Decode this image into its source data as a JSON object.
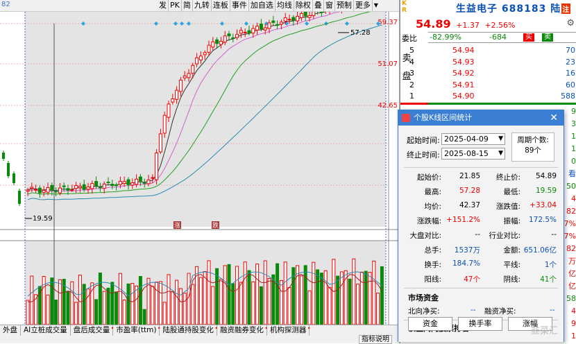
{
  "toolbar": {
    "code_fragment": "82",
    "buttons": [
      "发",
      "PK",
      "简",
      "九转",
      "连板",
      "事件",
      "加自选",
      "均线",
      "除权",
      "叠",
      "窗",
      "预制",
      "更多"
    ]
  },
  "chart": {
    "price_high_label": "57.28",
    "price_low_label": "19.59",
    "axis_labels": [
      "59.37",
      "51.07",
      "42.65"
    ],
    "event_markers": [
      "涨",
      "跌"
    ]
  },
  "bottom_tabs": [
    "外盘",
    "AI立桩成交量",
    "盘后成交量",
    "市盈率(ttm)",
    "陆股通持股变化",
    "融资融券变化",
    "机构探测器"
  ],
  "help_button": "指标说明",
  "quote": {
    "kr_badge": "KR",
    "name": "生益电子",
    "code": "688183",
    "lu_badge": "陆",
    "rz_badge": "注",
    "price": "54.89",
    "change": "+1.37",
    "change_pct": "+2.56%",
    "gear_icon": "gear-icon",
    "weibi_label": "委比",
    "weibi_value": "-82.99%",
    "weicha_value": "-684",
    "buy_label": "买",
    "sell_label": "卖",
    "ask_side_label": "卖盘",
    "asks": [
      {
        "level": "5",
        "price": "54.94",
        "volume": "70"
      },
      {
        "level": "4",
        "price": "54.93",
        "volume": "23"
      },
      {
        "level": "3",
        "price": "54.92",
        "volume": "16"
      },
      {
        "level": "2",
        "price": "54.91",
        "volume": "60"
      },
      {
        "level": "1",
        "price": "54.90",
        "volume": "588"
      }
    ],
    "side_values": [
      "9",
      "3",
      "1",
      "1",
      "0",
      "看",
      "50",
      "4",
      "82",
      "7%",
      "7%",
      "82",
      "万",
      "亿",
      "亿",
      "58",
      "4",
      "9",
      "1"
    ]
  },
  "dialog": {
    "title": "个股K线区间统计",
    "start_label": "起始时间:",
    "start_value": "2025-04-09",
    "end_label": "终止时间:",
    "end_value": "2025-08-15",
    "cycle_label": "周期个数:",
    "cycle_value": "89个",
    "stats_left": [
      {
        "label": "起始价:",
        "value": "21.85",
        "color": "black"
      },
      {
        "label": "最高:",
        "value": "57.28",
        "color": "red"
      },
      {
        "label": "均价:",
        "value": "42.37",
        "color": "black"
      },
      {
        "label": "涨跌幅:",
        "value": "+151.2%",
        "color": "red"
      },
      {
        "label": "大盘对比:",
        "value": "--",
        "color": "black"
      },
      {
        "label": "总手:",
        "value": "1537万",
        "color": "blue"
      },
      {
        "label": "换手:",
        "value": "184.7%",
        "color": "blue"
      },
      {
        "label": "阳线:",
        "value": "47个",
        "color": "red"
      }
    ],
    "stats_right": [
      {
        "label": "终止价:",
        "value": "54.89",
        "color": "black"
      },
      {
        "label": "最低:",
        "value": "19.59",
        "color": "green"
      },
      {
        "label": "涨跌值:",
        "value": "+33.04",
        "color": "red"
      },
      {
        "label": "振幅:",
        "value": "172.5%",
        "color": "blue"
      },
      {
        "label": "行业对比:",
        "value": "--",
        "color": "black"
      },
      {
        "label": "金额:",
        "value": "651.06亿",
        "color": "blue"
      },
      {
        "label": "平线:",
        "value": "1个",
        "color": "blue"
      },
      {
        "label": "阴线:",
        "value": "41个",
        "color": "green"
      }
    ],
    "fund_title": "市场资金",
    "north_label": "北向净买:",
    "north_value": "--",
    "margin_label": "融资净买:",
    "margin_value": "--",
    "rank_title": "该区间内股票排名",
    "rank_buttons": [
      "资金",
      "换手率",
      "涨幅"
    ],
    "watermark": "韭菜汇"
  }
}
